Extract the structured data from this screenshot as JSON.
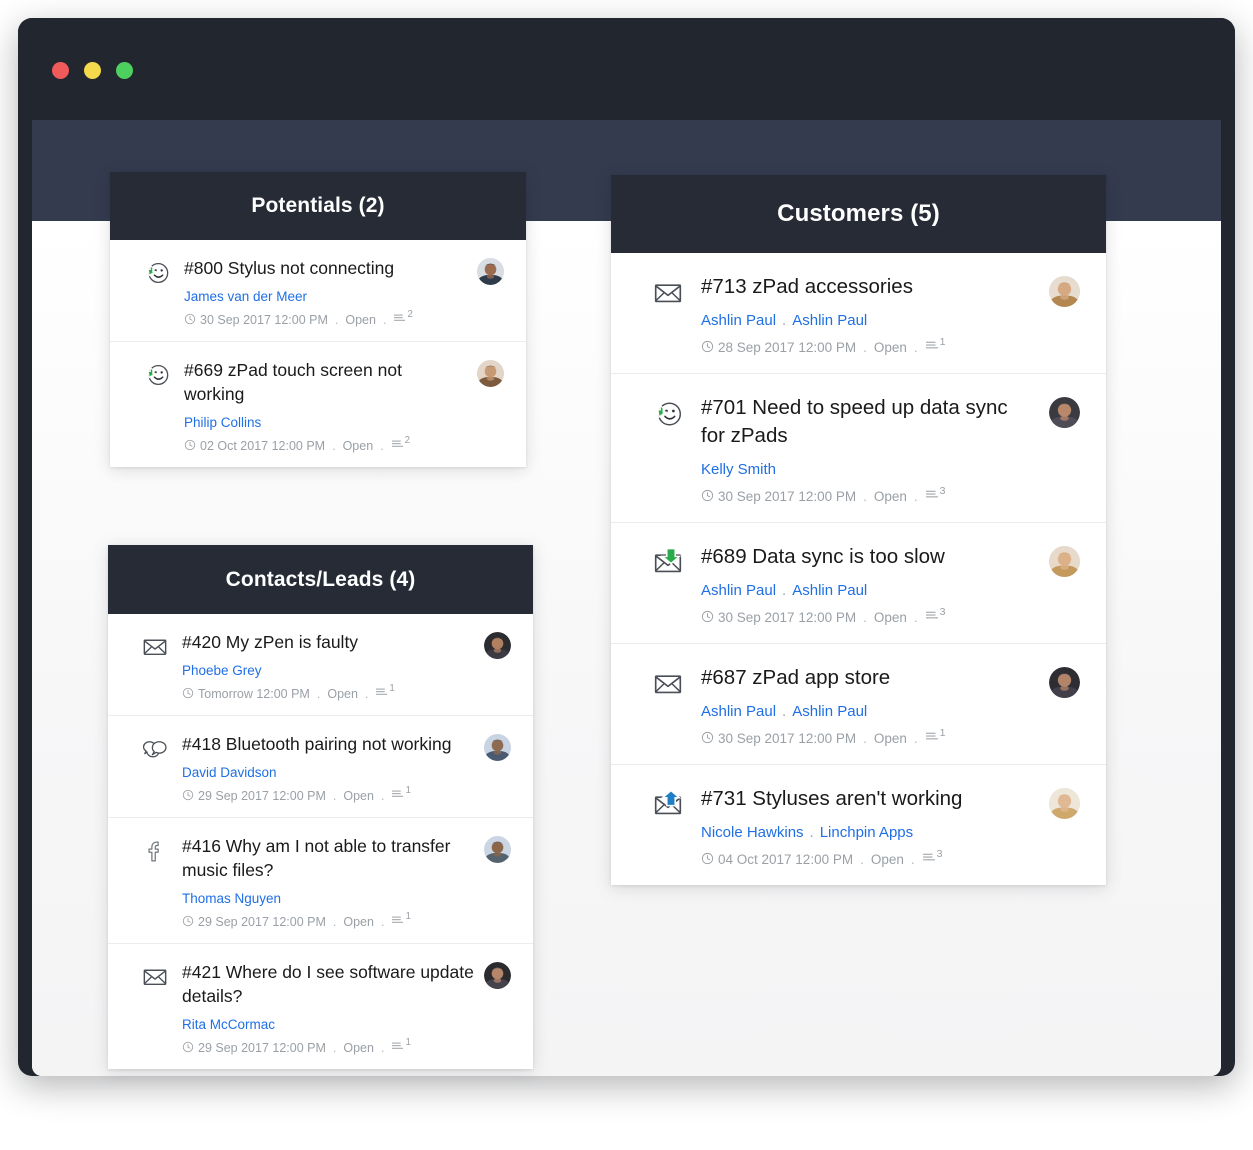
{
  "window": {
    "traffic_lights": [
      {
        "name": "close-button",
        "color": "#f05a5a"
      },
      {
        "name": "minimize-button",
        "color": "#f2da4c"
      },
      {
        "name": "maximize-button",
        "color": "#4ed05e"
      }
    ]
  },
  "colors": {
    "header_bg": "#262b35",
    "toolbar_bg": "#343b4f",
    "frame_bg": "#22262f",
    "link": "#1f6fe5",
    "meta_text": "#9aa0a6",
    "title_text": "#1a1a1a",
    "received_arrow": "#2aab4b",
    "sent_arrow": "#1f7fc4"
  },
  "panels": [
    {
      "id": "potentials",
      "title": "Potentials (2)",
      "count": 2,
      "tickets": [
        {
          "icon": "smiley-chat-received-icon",
          "title": "#800 Stylus not connecting",
          "ticket_id": "#800",
          "subject": "Stylus not connecting",
          "people": [
            "James van der Meer"
          ],
          "timestamp": "30 Sep 2017 12:00 PM",
          "status": "Open",
          "thread_count": "2",
          "avatar": "avatar-james-van-der-meer"
        },
        {
          "icon": "smiley-chat-received-icon",
          "title": "#669 zPad touch screen not working",
          "ticket_id": "#669",
          "subject": "zPad touch screen not working",
          "people": [
            "Philip Collins"
          ],
          "timestamp": "02 Oct 2017 12:00 PM",
          "status": "Open",
          "thread_count": "2",
          "avatar": "avatar-philip-collins"
        }
      ]
    },
    {
      "id": "contacts",
      "title": "Contacts/Leads (4)",
      "count": 4,
      "tickets": [
        {
          "icon": "envelope-icon",
          "title": "#420 My zPen is faulty",
          "ticket_id": "#420",
          "subject": "My zPen is faulty",
          "people": [
            "Phoebe Grey"
          ],
          "timestamp": "Tomorrow 12:00 PM",
          "status": "Open",
          "thread_count": "1",
          "avatar": "avatar-phoebe-grey"
        },
        {
          "icon": "chat-bubbles-icon",
          "title": "#418 Bluetooth pairing not working",
          "ticket_id": "#418",
          "subject": "Bluetooth pairing not working",
          "people": [
            "David Davidson"
          ],
          "timestamp": "29 Sep 2017 12:00 PM",
          "status": "Open",
          "thread_count": "1",
          "avatar": "avatar-david-davidson"
        },
        {
          "icon": "facebook-icon",
          "title": "#416 Why am I not able to transfer music files?",
          "ticket_id": "#416",
          "subject": "Why am I not able to transfer music files?",
          "people": [
            "Thomas Nguyen"
          ],
          "timestamp": "29 Sep 2017 12:00 PM",
          "status": "Open",
          "thread_count": "1",
          "avatar": "avatar-thomas-nguyen"
        },
        {
          "icon": "envelope-icon",
          "title": "#421 Where do I see software update details?",
          "ticket_id": "#421",
          "subject": "Where do I see software update details?",
          "people": [
            "Rita McCormac"
          ],
          "timestamp": "29 Sep 2017 12:00 PM",
          "status": "Open",
          "thread_count": "1",
          "avatar": "avatar-rita-mccormac"
        }
      ]
    },
    {
      "id": "customers",
      "title": "Customers (5)",
      "count": 5,
      "tickets": [
        {
          "icon": "envelope-icon",
          "title": "#713 zPad accessories",
          "ticket_id": "#713",
          "subject": "zPad accessories",
          "people": [
            "Ashlin Paul",
            "Ashlin Paul"
          ],
          "timestamp": "28 Sep 2017 12:00 PM",
          "status": "Open",
          "thread_count": "1",
          "avatar": "avatar-ashlin-paul"
        },
        {
          "icon": "smiley-chat-received-icon",
          "title": "#701 Need to speed up data sync for zPads",
          "ticket_id": "#701",
          "subject": "Need to speed up data sync for zPads",
          "people": [
            "Kelly Smith"
          ],
          "timestamp": "30 Sep 2017 12:00 PM",
          "status": "Open",
          "thread_count": "3",
          "avatar": "avatar-kelly-smith"
        },
        {
          "icon": "envelope-received-icon",
          "title": "#689 Data sync is too slow",
          "ticket_id": "#689",
          "subject": "Data sync is too slow",
          "people": [
            "Ashlin Paul",
            "Ashlin Paul"
          ],
          "timestamp": "30 Sep 2017 12:00 PM",
          "status": "Open",
          "thread_count": "3",
          "avatar": "avatar-ashlin-paul-2"
        },
        {
          "icon": "envelope-icon",
          "title": "#687 zPad app store",
          "ticket_id": "#687",
          "subject": "zPad app store",
          "people": [
            "Ashlin Paul",
            "Ashlin Paul"
          ],
          "timestamp": "30 Sep 2017 12:00 PM",
          "status": "Open",
          "thread_count": "1",
          "avatar": "avatar-ashlin-paul-3"
        },
        {
          "icon": "envelope-sent-icon",
          "title": "#731 Styluses aren't working",
          "ticket_id": "#731",
          "subject": "Styluses aren't working",
          "people": [
            "Nicole Hawkins",
            "Linchpin Apps"
          ],
          "timestamp": "04 Oct 2017 12:00 PM",
          "status": "Open",
          "thread_count": "3",
          "avatar": "avatar-nicole-hawkins"
        }
      ]
    }
  ]
}
